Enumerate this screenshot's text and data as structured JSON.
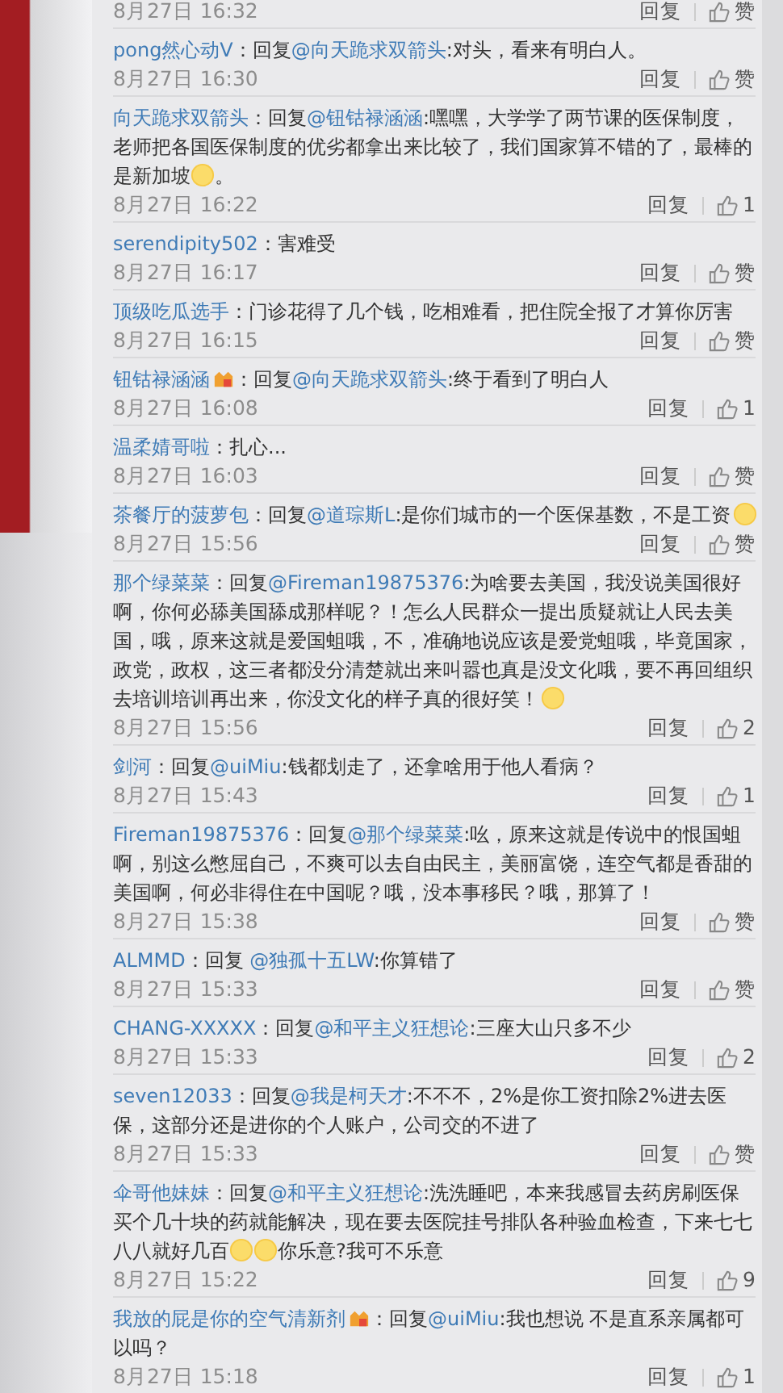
{
  "comments": [
    {
      "time": "8月27日 16:32",
      "reply_label": "回复",
      "likes": "赞"
    },
    {
      "user": "pong然心动V",
      "badge": false,
      "body": [
        {
          "kind": "text",
          "text": "：回复"
        },
        {
          "kind": "mention",
          "text": "@向天跪求双箭头"
        },
        {
          "kind": "text",
          "text": ":对头，看来有明白人。"
        }
      ],
      "time": "8月27日 16:30",
      "reply_label": "回复",
      "likes": "赞"
    },
    {
      "user": "向天跪求双箭头",
      "badge": false,
      "body": [
        {
          "kind": "text",
          "text": "：回复"
        },
        {
          "kind": "mention",
          "text": "@钮钴禄涵涵"
        },
        {
          "kind": "text",
          "text": ":嘿嘿，大学学了两节课的医保制度，老师把各国医保制度的优劣都拿出来比较了，我们国家算不错的了，最棒的是新加坡"
        },
        {
          "kind": "emoji"
        },
        {
          "kind": "text",
          "text": "。"
        }
      ],
      "time": "8月27日 16:22",
      "reply_label": "回复",
      "likes": "1"
    },
    {
      "user": "serendipity502",
      "badge": false,
      "body": [
        {
          "kind": "text",
          "text": "：害难受"
        }
      ],
      "time": "8月27日 16:17",
      "reply_label": "回复",
      "likes": "赞"
    },
    {
      "user": "顶级吃瓜选手",
      "badge": false,
      "body": [
        {
          "kind": "text",
          "text": "：门诊花得了几个钱，吃相难看，把住院全报了才算你厉害"
        }
      ],
      "time": "8月27日 16:15",
      "reply_label": "回复",
      "likes": "赞"
    },
    {
      "user": "钮钴禄涵涵",
      "badge": true,
      "body": [
        {
          "kind": "text",
          "text": "：回复"
        },
        {
          "kind": "mention",
          "text": "@向天跪求双箭头"
        },
        {
          "kind": "text",
          "text": ":终于看到了明白人"
        }
      ],
      "time": "8月27日 16:08",
      "reply_label": "回复",
      "likes": "1"
    },
    {
      "user": "温柔婧哥啦",
      "badge": false,
      "body": [
        {
          "kind": "text",
          "text": "：扎心..."
        }
      ],
      "time": "8月27日 16:03",
      "reply_label": "回复",
      "likes": "赞"
    },
    {
      "user": "茶餐厅的菠萝包",
      "badge": false,
      "body": [
        {
          "kind": "text",
          "text": "：回复"
        },
        {
          "kind": "mention",
          "text": "@道琮斯L"
        },
        {
          "kind": "text",
          "text": ":是你们城市的一个医保基数，不是工资"
        },
        {
          "kind": "emoji"
        }
      ],
      "time": "8月27日 15:56",
      "reply_label": "回复",
      "likes": "赞"
    },
    {
      "user": "那个绿菜菜",
      "badge": false,
      "body": [
        {
          "kind": "text",
          "text": "：回复"
        },
        {
          "kind": "mention",
          "text": "@Fireman19875376"
        },
        {
          "kind": "text",
          "text": ":为啥要去美国，我没说美国很好啊，你何必舔美国舔成那样呢？！怎么人民群众一提出质疑就让人民去美国，哦，原来这就是爱国蛆哦，不，准确地说应该是爱党蛆哦，毕竟国家，政党，政权，这三者都没分清楚就出来叫嚣也真是没文化哦，要不再回组织去培训培训再出来，你没文化的样子真的很好笑！"
        },
        {
          "kind": "emoji"
        }
      ],
      "time": "8月27日 15:56",
      "reply_label": "回复",
      "likes": "2"
    },
    {
      "user": "剑河",
      "badge": false,
      "body": [
        {
          "kind": "text",
          "text": "：回复"
        },
        {
          "kind": "mention",
          "text": "@uiMiu"
        },
        {
          "kind": "text",
          "text": ":钱都划走了，还拿啥用于他人看病？"
        }
      ],
      "time": "8月27日 15:43",
      "reply_label": "回复",
      "likes": "1"
    },
    {
      "user": "Fireman19875376",
      "badge": false,
      "body": [
        {
          "kind": "text",
          "text": "：回复"
        },
        {
          "kind": "mention",
          "text": "@那个绿菜菜"
        },
        {
          "kind": "text",
          "text": ":吆，原来这就是传说中的恨国蛆啊，别这么憋屈自己，不爽可以去自由民主，美丽富饶，连空气都是香甜的美国啊，何必非得住在中国呢？哦，没本事移民？哦，那算了！"
        }
      ],
      "time": "8月27日 15:38",
      "reply_label": "回复",
      "likes": "赞"
    },
    {
      "user": "ALMMD",
      "badge": false,
      "body": [
        {
          "kind": "text",
          "text": "：回复 "
        },
        {
          "kind": "mention",
          "text": "@独孤十五LW"
        },
        {
          "kind": "text",
          "text": ":你算错了"
        }
      ],
      "time": "8月27日 15:33",
      "reply_label": "回复",
      "likes": "赞"
    },
    {
      "user": "CHANG-XXXXX",
      "badge": false,
      "body": [
        {
          "kind": "text",
          "text": "：回复"
        },
        {
          "kind": "mention",
          "text": "@和平主义狂想论"
        },
        {
          "kind": "text",
          "text": ":三座大山只多不少"
        }
      ],
      "time": "8月27日 15:33",
      "reply_label": "回复",
      "likes": "2"
    },
    {
      "user": "seven12033",
      "badge": false,
      "body": [
        {
          "kind": "text",
          "text": "：回复"
        },
        {
          "kind": "mention",
          "text": "@我是柯天才"
        },
        {
          "kind": "text",
          "text": ":不不不，2%是你工资扣除2%进去医保，这部分还是进你的个人账户，公司交的不进了"
        }
      ],
      "time": "8月27日 15:33",
      "reply_label": "回复",
      "likes": "赞"
    },
    {
      "user": "伞哥他妹妹",
      "badge": false,
      "body": [
        {
          "kind": "text",
          "text": "：回复"
        },
        {
          "kind": "mention",
          "text": "@和平主义狂想论"
        },
        {
          "kind": "text",
          "text": ":洗洗睡吧，本来我感冒去药房刷医保买个几十块的药就能解决，现在要去医院挂号排队各种验血检查，下来七七八八就好几百"
        },
        {
          "kind": "emoji"
        },
        {
          "kind": "emoji"
        },
        {
          "kind": "text",
          "text": "你乐意?我可不乐意"
        }
      ],
      "time": "8月27日 15:22",
      "reply_label": "回复",
      "likes": "9"
    },
    {
      "user": "我放的屁是你的空气清新剂",
      "badge": true,
      "body": [
        {
          "kind": "text",
          "text": "：回复"
        },
        {
          "kind": "mention",
          "text": "@uiMiu"
        },
        {
          "kind": "text",
          "text": ":我也想说 不是直系亲属都可以吗？"
        }
      ],
      "time": "8月27日 15:18",
      "reply_label": "回复",
      "likes": "1"
    }
  ]
}
